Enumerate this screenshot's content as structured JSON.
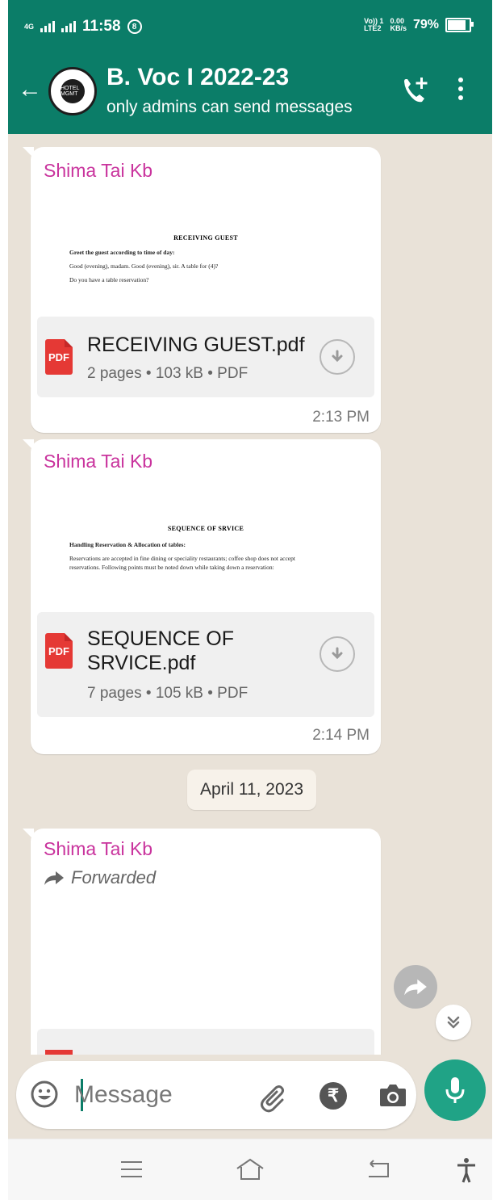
{
  "status": {
    "network": "4G",
    "time": "11:58",
    "alarm_badge": "8",
    "volte": "Vo)) 1",
    "lte": "LTE2",
    "speed_value": "0.00",
    "speed_unit": "KB/s",
    "battery_pct": "79%",
    "battery_level": 0.79
  },
  "header": {
    "group_name": "B. Voc I 2022-23",
    "subtitle": "only admins can send messages",
    "avatar_text": "HOTEL MGMT"
  },
  "messages": [
    {
      "sender": "Shima Tai Kb",
      "preview_heading": "RECEIVING GUEST",
      "preview_lines": [
        "Greet the guest according to time of day:",
        "Good (evening), madam. Good (evening), sir. A table for (4)?",
        "Do you have a table reservation?"
      ],
      "file_name": "RECEIVING GUEST.pdf",
      "file_meta": "2 pages • 103 kB • PDF",
      "time": "2:13 PM"
    },
    {
      "sender": "Shima Tai Kb",
      "preview_heading": "SEQUENCE OF SRVICE",
      "preview_lines": [
        "Handling Reservation & Allocation of tables:",
        "Reservations are accepted in fine dining or speciality restaurants; coffee shop does not accept",
        "reservations. Following points must be noted down while taking down a reservation:"
      ],
      "file_name": "SEQUENCE OF SRVICE.pdf",
      "file_meta": "7 pages • 105 kB • PDF",
      "time": "2:14 PM"
    },
    {
      "sender": "Shima Tai Kb",
      "forwarded_label": "Forwarded"
    }
  ],
  "date_chip": "April 11, 2023",
  "input": {
    "placeholder": "Message"
  },
  "pdf_badge": "PDF",
  "rupee_symbol": "₹",
  "colors": {
    "header": "#0b7d68",
    "sender": "#c9339d",
    "mic_button": "#20a386",
    "pdf_icon": "#e53935",
    "chat_background": "#e9e2d8"
  },
  "icons": [
    "back-arrow-icon",
    "add-call-icon",
    "more-options-icon",
    "pdf-icon",
    "download-icon",
    "forward-icon",
    "chevron-double-down-icon",
    "emoji-icon",
    "attach-icon",
    "rupee-icon",
    "camera-icon",
    "mic-icon",
    "menu-icon",
    "home-icon",
    "back-icon",
    "accessibility-icon"
  ]
}
